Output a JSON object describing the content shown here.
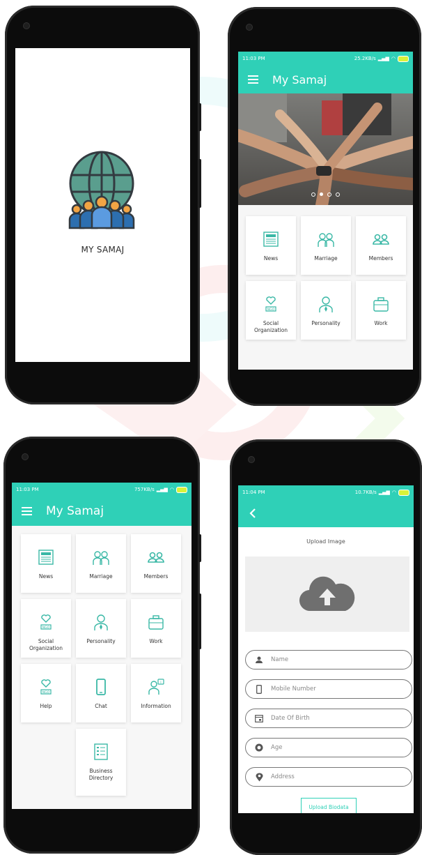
{
  "colors": {
    "accent": "#2fd0b7",
    "accent_dark": "#26bfa6"
  },
  "splash": {
    "app_name": "MY SAMAJ"
  },
  "home": {
    "status_time": "11:03 PM",
    "status_speed": "25.2KB/s",
    "title": "My Samaj",
    "carousel_dots": 4,
    "carousel_active_dot": 2,
    "tiles": [
      {
        "label": "News",
        "icon": "newspaper-icon"
      },
      {
        "label": "Marriage",
        "icon": "couple-icon"
      },
      {
        "label": "Members",
        "icon": "members-icon"
      },
      {
        "label": "Social\nOrganization",
        "icon": "ngo-icon"
      },
      {
        "label": "Personality",
        "icon": "person-icon"
      },
      {
        "label": "Work",
        "icon": "briefcase-icon"
      }
    ]
  },
  "menu": {
    "status_time": "11:03 PM",
    "status_speed": "757KB/s",
    "title": "My Samaj",
    "tiles": [
      {
        "label": "News",
        "icon": "newspaper-icon"
      },
      {
        "label": "Marriage",
        "icon": "couple-icon"
      },
      {
        "label": "Members",
        "icon": "members-icon"
      },
      {
        "label": "Social\nOrganization",
        "icon": "ngo-icon"
      },
      {
        "label": "Personality",
        "icon": "person-icon"
      },
      {
        "label": "Work",
        "icon": "briefcase-icon"
      },
      {
        "label": "Help",
        "icon": "ngo-help-icon"
      },
      {
        "label": "Chat",
        "icon": "phone-icon"
      },
      {
        "label": "Information",
        "icon": "info-desk-icon"
      },
      {
        "label": "Business\nDirectory",
        "icon": "directory-icon"
      }
    ]
  },
  "form": {
    "status_time": "11:04 PM",
    "status_speed": "10.7KB/s",
    "upload_image_label": "Upload Image",
    "fields": [
      {
        "placeholder": "Name",
        "icon": "person-icon"
      },
      {
        "placeholder": "Mobile Number",
        "icon": "phone-icon"
      },
      {
        "placeholder": "Date Of Birth",
        "icon": "calendar-icon"
      },
      {
        "placeholder": "Age",
        "icon": "age-icon"
      },
      {
        "placeholder": "Address",
        "icon": "location-icon"
      }
    ],
    "upload_biodata_label": "Upload Biodata"
  }
}
